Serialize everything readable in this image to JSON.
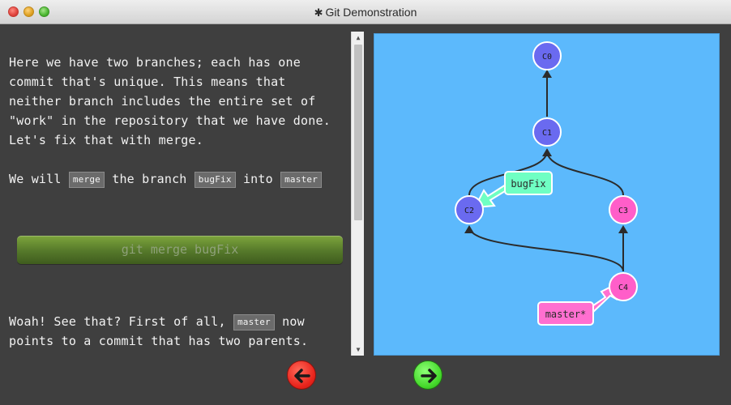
{
  "window": {
    "title": "Git Demonstration",
    "title_icon": "gear-icon"
  },
  "instructions": {
    "para1": "Here we have two branches; each has one commit that's unique. This means that neither branch includes the entire set of \"work\" in the repository that we have done. Let's fix that with merge.",
    "para2_prefix": "We will",
    "para2_code1": "merge",
    "para2_mid": "the branch",
    "para2_code2": "bugFix",
    "para2_mid2": "into",
    "para2_code3": "master",
    "command_button": "git merge bugFix",
    "para3_prefix": "Woah! See that? First of all,",
    "para3_code": "master",
    "para3_suffix": "now points to a commit that has two parents."
  },
  "graph": {
    "commits": [
      {
        "id": "C0",
        "color": "#6a6af0"
      },
      {
        "id": "C1",
        "color": "#6a6af0"
      },
      {
        "id": "C2",
        "color": "#6a6af0"
      },
      {
        "id": "C3",
        "color": "#ff5ec9"
      },
      {
        "id": "C4",
        "color": "#ff5ec9"
      }
    ],
    "branches": [
      {
        "name": "bugFix",
        "color": "#6fffc3",
        "target": "C2"
      },
      {
        "name": "master*",
        "color": "#ff6fd0",
        "target": "C4"
      }
    ],
    "background": "#5cb9fc"
  },
  "nav": {
    "back_icon": "arrow-left-icon",
    "forward_icon": "arrow-right-icon",
    "back_color": "#e8231b",
    "forward_color": "#44d92a"
  }
}
